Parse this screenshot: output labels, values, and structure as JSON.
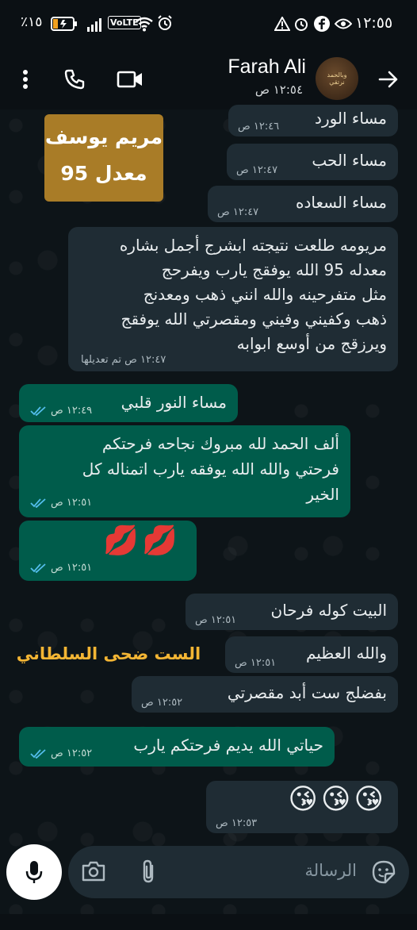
{
  "status_bar": {
    "battery": "٪١٥",
    "network": "VoLTE",
    "time": "١٢:٥٥"
  },
  "header": {
    "contact_name": "Farah Ali",
    "last_seen": "١٢:٥٤ ص"
  },
  "name_card": {
    "line1": "مريم يوسف",
    "line2": "معدل 95"
  },
  "messages": [
    {
      "dir": "in",
      "lines": [
        "مساء الورد"
      ],
      "time": "١٢:٤٦ ص"
    },
    {
      "dir": "in",
      "lines": [
        "مساء الحب"
      ],
      "time": "١٢:٤٧ ص"
    },
    {
      "dir": "in",
      "lines": [
        "مساء السعاده"
      ],
      "time": "١٢:٤٧ ص"
    },
    {
      "dir": "in",
      "lines": [
        "مريومه طلعت نتيجته ابشرج أجمل بشاره",
        "معدله 95 الله يوفقج يارب ويفرحج",
        "مثل متفرحينه والله انني ذهب ومعدنج",
        "ذهب وكفيني وفيني ومقصرتي الله يوفقج",
        "ويرزقج من أوسع ابوابه"
      ],
      "time": "١٢:٤٧ ص",
      "edited": "تم تعديلها"
    },
    {
      "dir": "out",
      "lines": [
        "مساء النور قلبي"
      ],
      "time": "١٢:٤٩ ص"
    },
    {
      "dir": "out",
      "lines": [
        "ألف الحمد لله مبروك نجاحه فرحتكم",
        "فرحتي والله الله يوفقه يارب اتمناله كل",
        "الخير"
      ],
      "time": "١٢:٥١ ص"
    },
    {
      "dir": "out",
      "lines": [
        "💋💋"
      ],
      "time": "١٢:٥١ ص"
    },
    {
      "dir": "in",
      "lines": [
        "البيت كوله فرحان"
      ],
      "time": "١٢:٥١ ص"
    },
    {
      "dir": "in",
      "lines": [
        "والله العظيم"
      ],
      "time": "١٢:٥١ ص"
    },
    {
      "dir": "in",
      "lines": [
        "بفضلج ست أبد مقصرتي"
      ],
      "time": "١٢:٥٢ ص"
    },
    {
      "dir": "out",
      "lines": [
        "حياتي الله يديم فرحتكم يارب"
      ],
      "time": "١٢:٥٢ ص"
    },
    {
      "dir": "in",
      "lines": [
        "😘😘😘"
      ],
      "time": "١٢:٥٣ ص"
    }
  ],
  "signature": "الست ضحى السلطاني",
  "input": {
    "placeholder": "الرسالة"
  },
  "colors": {
    "incoming_bubble": "#1f2c34",
    "outgoing_bubble": "#005c4b",
    "read_ticks": "#53bdeb",
    "name_card": "#a97c27",
    "signature": "#f3b534"
  }
}
